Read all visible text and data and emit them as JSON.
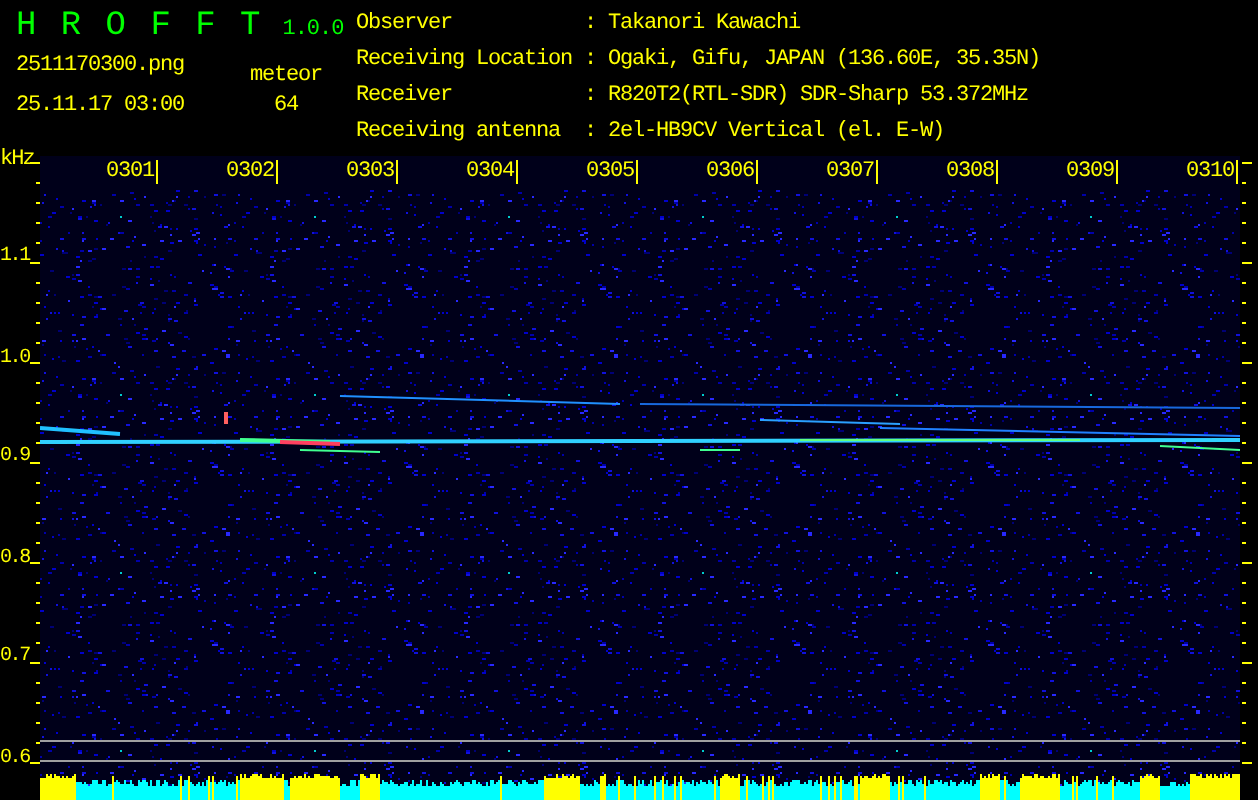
{
  "app": {
    "name": "H R O F F T",
    "version": "1.0.0"
  },
  "file_name": "2511170300.png",
  "timestamp": "25.11.17 03:00",
  "meteor": {
    "label": "meteor",
    "count": "64"
  },
  "info": [
    {
      "label": "Observer",
      "value": ": Takanori Kawachi"
    },
    {
      "label": "Receiving Location",
      "value": ": Ogaki, Gifu, JAPAN (136.60E, 35.35N)"
    },
    {
      "label": "Receiver",
      "value": ": R820T2(RTL-SDR) SDR-Sharp 53.372MHz"
    },
    {
      "label": "Receiving antenna",
      "value": ": 2el-HB9CV Vertical (el. E-W)"
    }
  ],
  "y_unit": "kHz",
  "y_ticks": [
    "1.1",
    "1.0",
    "0.9",
    "0.8",
    "0.7",
    "0.6"
  ],
  "time_labels": [
    "0301",
    "0302",
    "0303",
    "0304",
    "0305",
    "0306",
    "0307",
    "0308",
    "0309",
    "0310"
  ]
}
